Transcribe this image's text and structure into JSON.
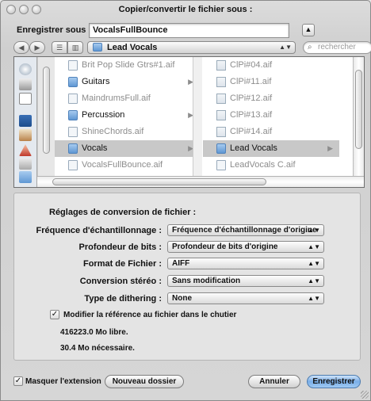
{
  "window": {
    "title": "Copier/convertir le fichier sous :"
  },
  "save": {
    "label": "Enregistrer sous :",
    "filename": "VocalsFullBounce"
  },
  "toolbar": {
    "location": "Lead Vocals",
    "search_placeholder": "rechercher"
  },
  "column1": [
    {
      "name": "Brit Pop Slide Gtrs#1.aif",
      "kind": "file",
      "dim": true
    },
    {
      "name": "Guitars",
      "kind": "folder",
      "dim": false,
      "chevron": true
    },
    {
      "name": "MaindrumsFull.aif",
      "kind": "file",
      "dim": true
    },
    {
      "name": "Percussion",
      "kind": "folder",
      "dim": false,
      "chevron": true
    },
    {
      "name": "ShineChords.aif",
      "kind": "file",
      "dim": true
    },
    {
      "name": "Vocals",
      "kind": "folder",
      "dim": false,
      "chevron": true,
      "selected": true
    },
    {
      "name": "VocalsFullBounce.aif",
      "kind": "file",
      "dim": true
    }
  ],
  "column2": [
    {
      "name": "ClPi#04.aif",
      "kind": "audio",
      "dim": true
    },
    {
      "name": "ClPi#11.aif",
      "kind": "audio",
      "dim": true
    },
    {
      "name": "ClPi#12.aif",
      "kind": "audio",
      "dim": true
    },
    {
      "name": "ClPi#13.aif",
      "kind": "audio",
      "dim": true
    },
    {
      "name": "ClPi#14.aif",
      "kind": "audio",
      "dim": true
    },
    {
      "name": "Lead Vocals",
      "kind": "folder",
      "dim": false,
      "chevron": true,
      "selected": true
    },
    {
      "name": "LeadVocals C.aif",
      "kind": "file",
      "dim": true
    }
  ],
  "settings": {
    "heading": "Réglages de conversion de fichier :",
    "sample_rate": {
      "label": "Fréquence d'échantillonnage :",
      "value": "Fréquence d'échantillonnage d'origine"
    },
    "bit_depth": {
      "label": "Profondeur de bits :",
      "value": "Profondeur de bits d'origine"
    },
    "file_format": {
      "label": "Format de Fichier :",
      "value": "AIFF"
    },
    "stereo": {
      "label": "Conversion stéréo :",
      "value": "Sans modification"
    },
    "dither": {
      "label": "Type de dithering :",
      "value": "None"
    },
    "modify_ref": {
      "label": "Modifier la référence au fichier dans le chutier",
      "checked": true
    },
    "free": "416223.0 Mo libre.",
    "needed": "30.4 Mo nécessaire."
  },
  "footer": {
    "hide_extension": "Masquer l'extension",
    "new_folder": "Nouveau dossier",
    "cancel": "Annuler",
    "save": "Enregistrer"
  }
}
